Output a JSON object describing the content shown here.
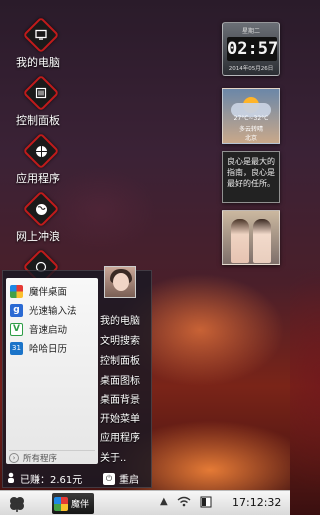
{
  "desktop_icons": [
    {
      "label": "我的电脑",
      "icon": "computer-monitor-icon"
    },
    {
      "label": "控制面板",
      "icon": "control-panel-icon"
    },
    {
      "label": "应用程序",
      "icon": "apps-icon"
    },
    {
      "label": "网上冲浪",
      "icon": "globe-icon"
    }
  ],
  "clock_widget": {
    "weekday": "星期二",
    "time": "02:57",
    "date": "2014年05月26日"
  },
  "weather_widget": {
    "temp": "27°C~32°C",
    "desc": "多云转晴",
    "city": "北京"
  },
  "note_widget": {
    "text": "良心是最大的 指南，良心是 最好的任所。"
  },
  "start_menu": {
    "left_items": [
      {
        "label": "魔伴桌面",
        "icon": "mobanzhuomian-icon",
        "color": "#3a7bd5"
      },
      {
        "label": "光速输入法",
        "icon": "keyboard-g-icon",
        "color": "#2b6ad3"
      },
      {
        "label": "音速启动",
        "icon": "v-launch-icon",
        "color": "#2e9e47"
      },
      {
        "label": "哈哈日历",
        "icon": "calendar-icon",
        "color": "#1b74c9"
      }
    ],
    "all_programs": "所有程序",
    "right_items": [
      "我的电脑",
      "文明搜索",
      "控制面板",
      "桌面图标",
      "桌面背景",
      "开始菜单",
      "应用程序",
      "关于.."
    ],
    "earned_label": "已赚：2.61元",
    "restart_label": "重启"
  },
  "taskbar": {
    "app_label": "魔伴",
    "time": "17:12:32"
  }
}
